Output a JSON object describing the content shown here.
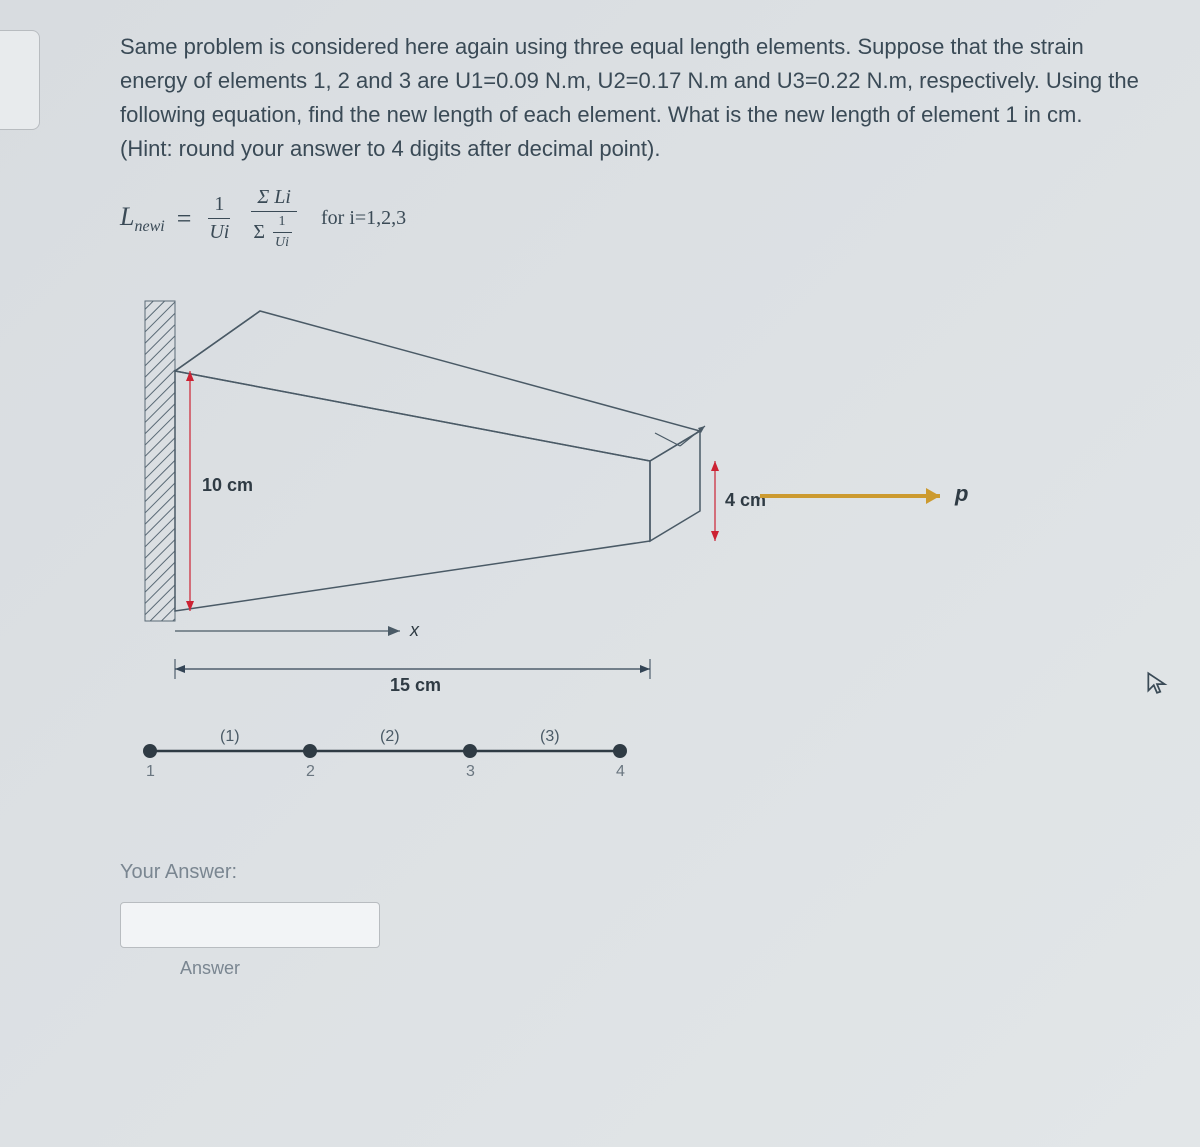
{
  "problem_text": "Same problem is considered here again using three equal length elements. Suppose that the strain energy of elements 1, 2 and 3 are U1=0.09 N.m, U2=0.17 N.m and U3=0.22 N.m, respectively. Using the following equation, find the new length of each element. What is the new length of element 1 in cm. (Hint: round your answer to 4 digits after decimal point).",
  "formula": {
    "lhs": "L",
    "lhs_sub": "newi",
    "eq": "=",
    "f1_num": "1",
    "f1_den": "Ui",
    "f2_num": "Σ Li",
    "f2_den_a": "Σ",
    "f2_den_b_num": "1",
    "f2_den_b_den": "Ui",
    "for_text": "for i=1,2,3"
  },
  "diagram": {
    "h_left": "10 cm",
    "h_right": "4 cm",
    "length": "15 cm",
    "x_axis": "x",
    "load": "p",
    "nodes": {
      "n1": "1",
      "n2": "2",
      "n3": "3",
      "n4": "4"
    },
    "elements": {
      "e1": "(1)",
      "e2": "(2)",
      "e3": "(3)"
    }
  },
  "answer": {
    "label": "Your Answer:",
    "placeholder": "",
    "value": "",
    "sublabel": "Answer"
  }
}
